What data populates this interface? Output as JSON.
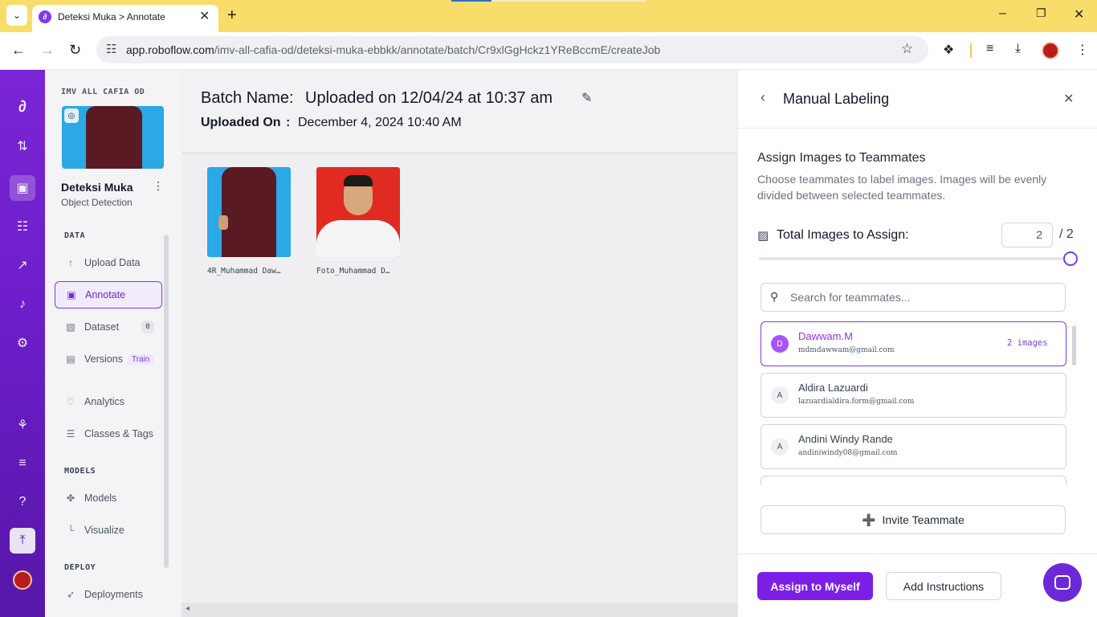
{
  "browser": {
    "tab_title": "Deteksi Muka > Annotate",
    "tab_favicon": "roboflow-logo-icon",
    "url_host": "app.roboflow.com",
    "url_path": "/imv-all-cafia-od/deteksi-muka-ebbkk/annotate/batch/Cr9xlGgHckz1YReBccmE/createJob"
  },
  "workspace": {
    "name": "IMV ALL CAFIA OD",
    "project_name": "Deteksi Muka",
    "project_type": "Object Detection"
  },
  "sidebar": {
    "sections": {
      "data": "DATA",
      "models": "MODELS",
      "deploy": "DEPLOY"
    },
    "items": [
      {
        "label": "Upload Data",
        "icon": "upload-arrow-icon"
      },
      {
        "label": "Annotate",
        "icon": "annotate-icon",
        "active": true
      },
      {
        "label": "Dataset",
        "icon": "image-icon",
        "badge": "0"
      },
      {
        "label": "Versions",
        "icon": "versions-icon",
        "badge": "Train"
      },
      {
        "label": "Analytics",
        "icon": "analytics-icon"
      },
      {
        "label": "Classes & Tags",
        "icon": "list-icon"
      },
      {
        "label": "Models",
        "icon": "models-icon"
      },
      {
        "label": "Visualize",
        "icon": "chart-icon"
      },
      {
        "label": "Deployments",
        "icon": "rocket-icon"
      }
    ]
  },
  "batch": {
    "name_label": "Batch Name:",
    "name_value": "Uploaded on 12/04/24 at 10:37 am",
    "uploaded_label": "Uploaded On",
    "uploaded_sep": ":",
    "uploaded_value": "December 4, 2024 10:40 AM",
    "images": [
      {
        "caption": "4R_Muhammad Daw…"
      },
      {
        "caption": "Foto_Muhammad D…"
      }
    ]
  },
  "drawer": {
    "title": "Manual Labeling",
    "assign_title": "Assign Images to Teammates",
    "assign_desc": "Choose teammates to label images. Images will be evenly divided between selected teammates.",
    "total_label": "Total Images to Assign:",
    "total_value": "2",
    "total_of": "/ 2",
    "slider_fraction": 1.0,
    "search_placeholder": "Search for teammates...",
    "teammates": [
      {
        "initial": "D",
        "name": "Dawwam.M",
        "email": "mdmdawwam@gmail.com",
        "count": "2 images",
        "selected": true
      },
      {
        "initial": "A",
        "name": "Aldira Lazuardi",
        "email": "lazuardialdira.form@gmail.com",
        "count": "",
        "selected": false
      },
      {
        "initial": "A",
        "name": "Andini Windy Rande",
        "email": "andiniwindy08@gmail.com",
        "count": "",
        "selected": false
      }
    ],
    "invite_label": "Invite Teammate",
    "assign_self_label": "Assign to Myself",
    "add_instructions_label": "Add Instructions"
  },
  "colors": {
    "accent": "#7c3aed",
    "rail": "#6c1ec9",
    "tabbar": "#f9dd6b"
  }
}
